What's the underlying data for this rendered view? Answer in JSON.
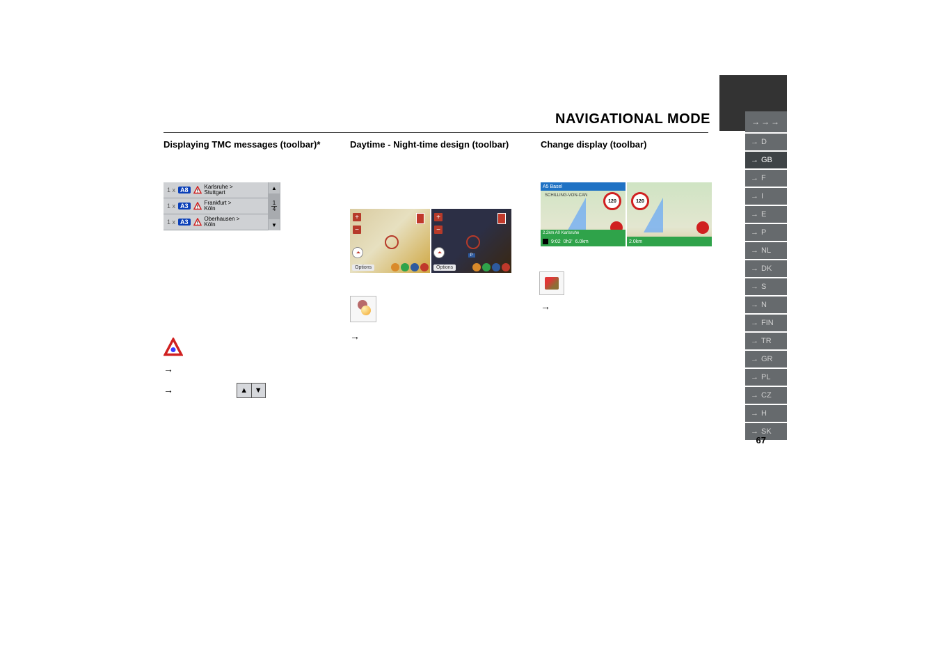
{
  "page_title": "NAVIGATIONAL MODE",
  "page_number": "67",
  "columns": {
    "c1": "Displaying TMC messages (toolbar)*",
    "c2": "Daytime - Night-time design (toolbar)",
    "c3": "Change display (toolbar)"
  },
  "tmc": {
    "rows": [
      {
        "count": "1 x",
        "road": "A8",
        "line1": "Karlsruhe >",
        "line2": "Stuttgart"
      },
      {
        "count": "1 x",
        "road": "A3",
        "line1": "Frankfurt >",
        "line2": "Köln"
      },
      {
        "count": "1 x",
        "road": "A3",
        "line1": "Oberhausen >",
        "line2": "Köln"
      }
    ],
    "page_indicator_top": "1",
    "page_indicator_bottom": "4",
    "up": "▲",
    "down": "▼"
  },
  "map": {
    "options_label": "Options",
    "dest": "A5 Basel",
    "speed_limit": "120",
    "street": "SCHILLING-VON-CAN",
    "bottom_left": "2.2km  A0 Karlsruhe",
    "bottom_right": "2.0km",
    "time_left": "9:02",
    "time_mid": "0h3'",
    "dist_right": "6.0km"
  },
  "arrows": {
    "small": "→",
    "head": "→→→"
  },
  "countries": {
    "items": [
      "D",
      "GB",
      "F",
      "I",
      "E",
      "P",
      "NL",
      "DK",
      "S",
      "N",
      "FIN",
      "TR",
      "GR",
      "PL",
      "CZ",
      "H",
      "SK"
    ],
    "active": "GB"
  },
  "updown": {
    "up": "▲",
    "down": "▼"
  }
}
